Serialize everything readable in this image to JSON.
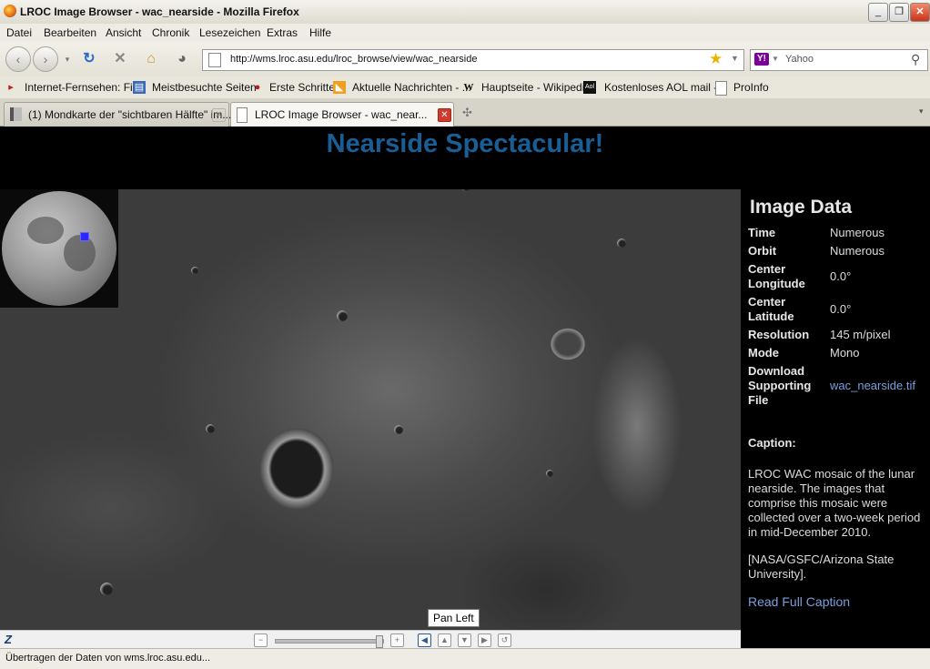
{
  "window": {
    "title": "LROC Image Browser - wac_nearside - Mozilla Firefox"
  },
  "menu": [
    "Datei",
    "Bearbeiten",
    "Ansicht",
    "Chronik",
    "Lesezeichen",
    "Extras",
    "Hilfe"
  ],
  "nav": {
    "url": "http://wms.lroc.asu.edu/lroc_browse/view/wac_nearside",
    "search_engine": "Y!",
    "search_placeholder": "Yahoo"
  },
  "bookmarks": [
    "Internet-Fernsehen: Fil...",
    "Meistbesuchte Seiten",
    "Erste Schritte",
    "Aktuelle Nachrichten - ...",
    "Hauptseite - Wikipedia",
    "Kostenloses AOL mail -...",
    "ProInfo"
  ],
  "tabs": [
    {
      "label": "(1) Mondkarte der \"sichtbaren Hälfte\" im..."
    },
    {
      "label": "LROC Image Browser - wac_near..."
    }
  ],
  "page": {
    "heading": "Nearside Spectacular!",
    "tooltip": "Pan Left",
    "panel": {
      "title": "Image Data",
      "rows": [
        {
          "key": "Time",
          "value": "Numerous"
        },
        {
          "key": "Orbit",
          "value": "Numerous"
        },
        {
          "key": "Center Longitude",
          "value": "0.0°"
        },
        {
          "key": "Center Latitude",
          "value": "0.0°"
        },
        {
          "key": "Resolution",
          "value": "145 m/pixel"
        },
        {
          "key": "Mode",
          "value": "Mono"
        },
        {
          "key": "Download Supporting File",
          "value": "wac_nearside.tif"
        }
      ],
      "caption_label": "Caption:",
      "caption_text": "LROC WAC mosaic of the lunar nearside. The images that comprise this mosaic were collected over a two-week period in mid-December 2010.",
      "caption_credit": "[NASA/GSFC/Arizona State University].",
      "read_more": "Read Full Caption"
    }
  },
  "status": "Übertragen der Daten von wms.lroc.asu.edu..."
}
